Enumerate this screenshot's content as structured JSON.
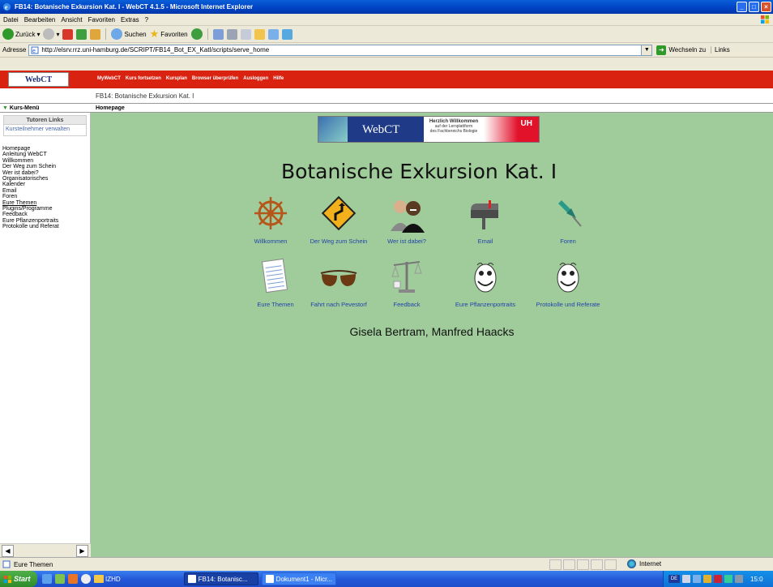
{
  "window": {
    "title": "FB14: Botanische Exkursion Kat. I - WebCT 4.1.5 - Microsoft Internet Explorer",
    "buttons": {
      "minimize": "_",
      "maximize": "□",
      "close": "×"
    }
  },
  "menubar": [
    "Datei",
    "Bearbeiten",
    "Ansicht",
    "Favoriten",
    "Extras",
    "?"
  ],
  "toolbar": {
    "back": "Zurück",
    "search": "Suchen",
    "favorites": "Favoriten"
  },
  "address": {
    "label": "Adresse",
    "url": "http://elsrv.rrz.uni-hamburg.de/SCRIPT/FB14_Bot_EX_KatI/scripts/serve_home",
    "go": "Wechseln zu",
    "links": "Links"
  },
  "webct": {
    "logo": "WebCT",
    "nav": [
      "MyWebCT",
      "Kurs fortsetzen",
      "Kursplan",
      "Browser überprüfen",
      "Ausloggen",
      "Hilfe"
    ],
    "course_title": "FB14: Botanische Exkursion Kat. I",
    "kurs_menu": "Kurs-Menü",
    "homepage_crumb": "Homepage"
  },
  "sidebar": {
    "tutoren_heading": "Tutoren Links",
    "tutoren_links": [
      "Kursteilnehmer verwalten"
    ],
    "items": [
      "Homepage",
      "Anleitung WebCT",
      "Willkommen",
      "Der Weg zum Schein",
      "Wer ist dabei?",
      "Organisatorisches",
      "Kalender",
      "Email",
      "Foren",
      "Eure Themen",
      "Plugins/Programme",
      "Feedback",
      "Eure Pflanzenportraits",
      "Protokolle und Referat"
    ]
  },
  "main": {
    "banner": {
      "brand": "WebCT",
      "welcome": "Herzlich Willkommen",
      "subtitle1": "auf der Lernplattform",
      "subtitle2": "des Fachbereichs Biologie",
      "uni": "UH"
    },
    "title": "Botanische Exkursion Kat. I",
    "icons_row1": [
      {
        "label": "Willkommen",
        "icon": "ship-wheel-icon"
      },
      {
        "label": "Der Weg zum Schein",
        "icon": "road-sign-icon"
      },
      {
        "label": "Wer ist dabei?",
        "icon": "people-photo-icon"
      },
      {
        "label": "Email",
        "icon": "mailbox-icon"
      },
      {
        "label": "Foren",
        "icon": "pushpin-icon"
      }
    ],
    "icons_row2": [
      {
        "label": "Eure Themen",
        "icon": "notepad-icon"
      },
      {
        "label": "Fahrt nach Pevestorf",
        "icon": "sunglasses-icon"
      },
      {
        "label": "Feedback",
        "icon": "scale-icon"
      },
      {
        "label": "Eure Pflanzenportraits",
        "icon": "smiley-face-icon"
      },
      {
        "label": "Protokolle und Referate",
        "icon": "smiley-face-icon"
      }
    ],
    "authors": "Gisela Bertram, Manfred Haacks"
  },
  "statusbar": {
    "text": "Eure Themen",
    "zone": "Internet"
  },
  "taskbar": {
    "start": "Start",
    "folder": "IZHD",
    "tasks": [
      "FB14: Botanisc...",
      "Dokument1 - Micr..."
    ],
    "tray_lang": "DE",
    "clock": "15:0"
  },
  "colors": {
    "webct_red": "#d92310",
    "content_green": "#9fcc9a",
    "link_blue": "#2244aa"
  }
}
